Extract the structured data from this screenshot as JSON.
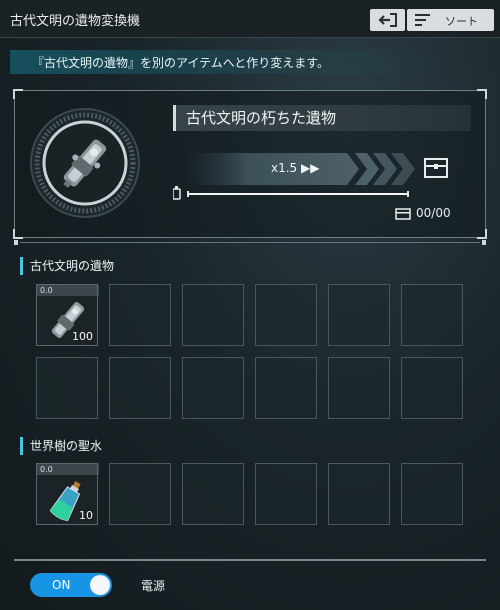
{
  "window": {
    "title": "古代文明の遺物変換機"
  },
  "toolbar": {
    "sort_label": "ソート"
  },
  "description": "『古代文明の遺物』を別のアイテムへと作り変えます。",
  "converter": {
    "item_name": "古代文明の朽ちた遺物",
    "speed": "x1.5 ▶▶",
    "progress_fraction": 1.0,
    "count": "00/00"
  },
  "sections": [
    {
      "title": "古代文明の遺物",
      "slots": [
        {
          "level": "0.0",
          "qty": "100",
          "icon": "relic-icon"
        }
      ]
    },
    {
      "title": "世界樹の聖水",
      "slots": [
        {
          "level": "0.0",
          "qty": "10",
          "icon": "holy-water-potion-icon"
        }
      ]
    }
  ],
  "power": {
    "toggle_label": "ON",
    "label": "電源",
    "state": true
  },
  "colors": {
    "accent": "#1794e4",
    "cyan": "#4ec3dd"
  }
}
